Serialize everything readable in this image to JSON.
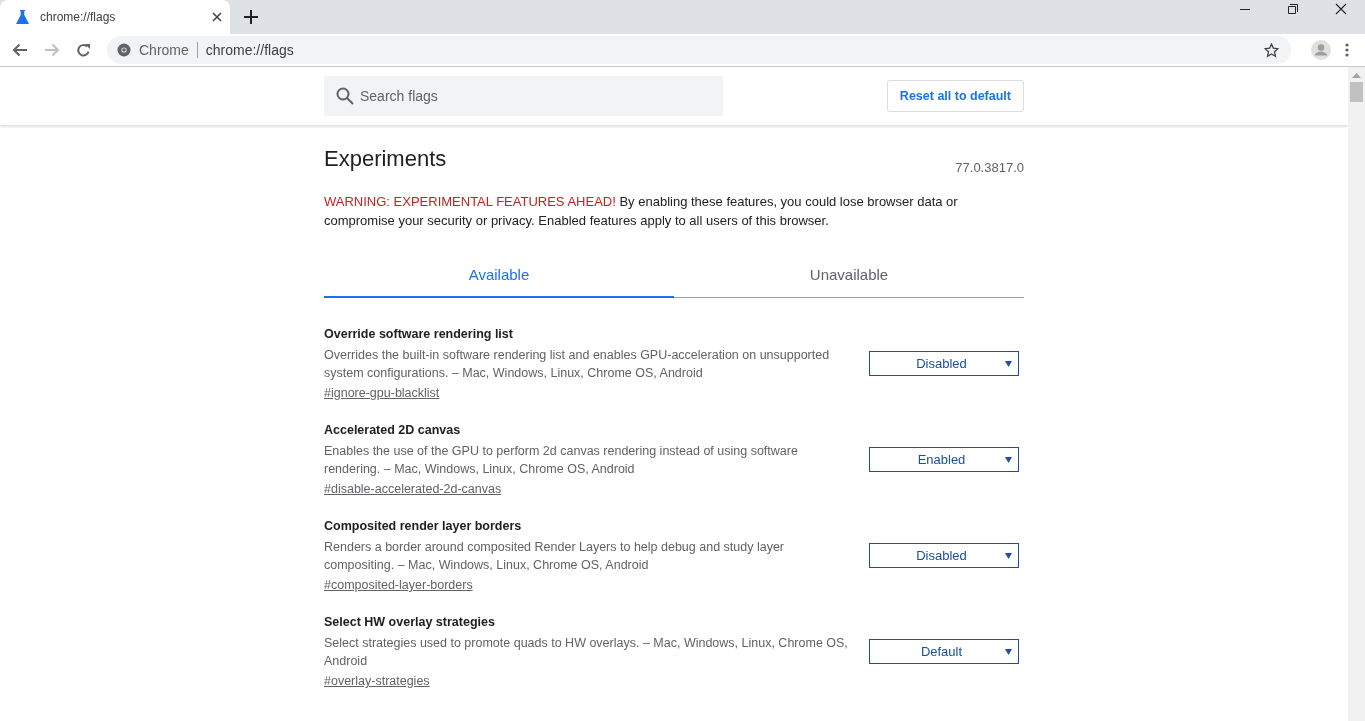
{
  "window": {
    "tab": {
      "title": "chrome://flags",
      "selected": true
    }
  },
  "toolbar": {
    "site_label": "Chrome",
    "url": "chrome://flags"
  },
  "header": {
    "search": {
      "placeholder": "Search flags"
    },
    "reset_button": "Reset all to default"
  },
  "intro": {
    "title": "Experiments",
    "version": "77.0.3817.0",
    "warning": "WARNING: EXPERIMENTAL FEATURES AHEAD!",
    "warning_text": "By enabling these features, you could lose browser data or compromise your security or privacy. Enabled features apply to all users of this browser."
  },
  "tabs": [
    {
      "label": "Available",
      "selected": true
    },
    {
      "label": "Unavailable",
      "selected": false
    }
  ],
  "flags": [
    {
      "title": "Override software rendering list",
      "description": "Overrides the built-in software rendering list and enables GPU-acceleration on unsupported system configurations. – Mac, Windows, Linux, Chrome OS, Android",
      "link": "#ignore-gpu-blacklist",
      "value": "Disabled"
    },
    {
      "title": "Accelerated 2D canvas",
      "description": "Enables the use of the GPU to perform 2d canvas rendering instead of using software rendering. – Mac, Windows, Linux, Chrome OS, Android",
      "link": "#disable-accelerated-2d-canvas",
      "value": "Enabled"
    },
    {
      "title": "Composited render layer borders",
      "description": "Renders a border around composited Render Layers to help debug and study layer compositing. – Mac, Windows, Linux, Chrome OS, Android",
      "link": "#composited-layer-borders",
      "value": "Disabled"
    },
    {
      "title": "Select HW overlay strategies",
      "description": "Select strategies used to promote quads to HW overlays. – Mac, Windows, Linux, Chrome OS, Android",
      "link": "#overlay-strategies",
      "value": "Default"
    }
  ]
}
